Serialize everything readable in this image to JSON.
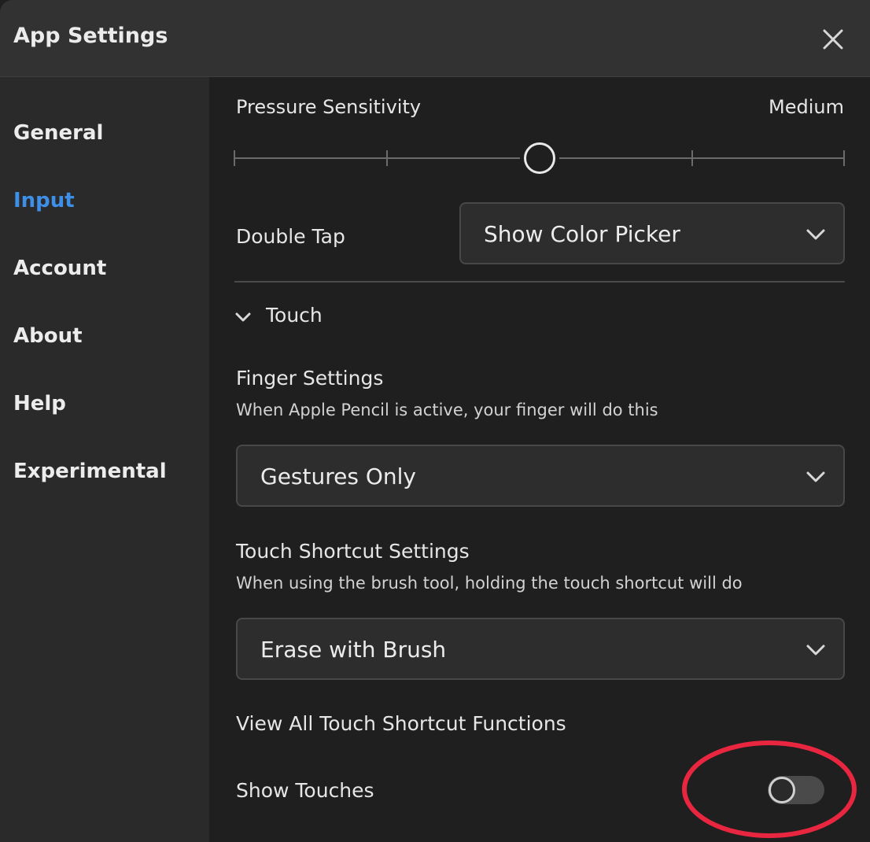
{
  "window": {
    "title": "App Settings"
  },
  "sidebar": {
    "items": [
      {
        "label": "General",
        "active": false
      },
      {
        "label": "Input",
        "active": true
      },
      {
        "label": "Account",
        "active": false
      },
      {
        "label": "About",
        "active": false
      },
      {
        "label": "Help",
        "active": false
      },
      {
        "label": "Experimental",
        "active": false
      }
    ]
  },
  "pressure": {
    "label": "Pressure Sensitivity",
    "value_text": "Medium",
    "levels": 5,
    "level_index": 2
  },
  "double_tap": {
    "label": "Double Tap",
    "selected": "Show Color Picker"
  },
  "touch_section": {
    "label": "Touch",
    "expanded": true
  },
  "finger_settings": {
    "label": "Finger Settings",
    "description": "When Apple Pencil is active, your finger will do this",
    "selected": "Gestures Only"
  },
  "touch_shortcut": {
    "label": "Touch Shortcut Settings",
    "description": "When using the brush tool, holding the touch shortcut will do",
    "selected": "Erase with Brush"
  },
  "view_all_link": {
    "label": "View All Touch Shortcut Functions"
  },
  "show_touches": {
    "label": "Show Touches",
    "enabled": false
  },
  "colors": {
    "accent": "#3d8fe8",
    "annotation": "#e8263f",
    "background": "#1f1f1f",
    "sidebar": "#2a2a2a"
  }
}
